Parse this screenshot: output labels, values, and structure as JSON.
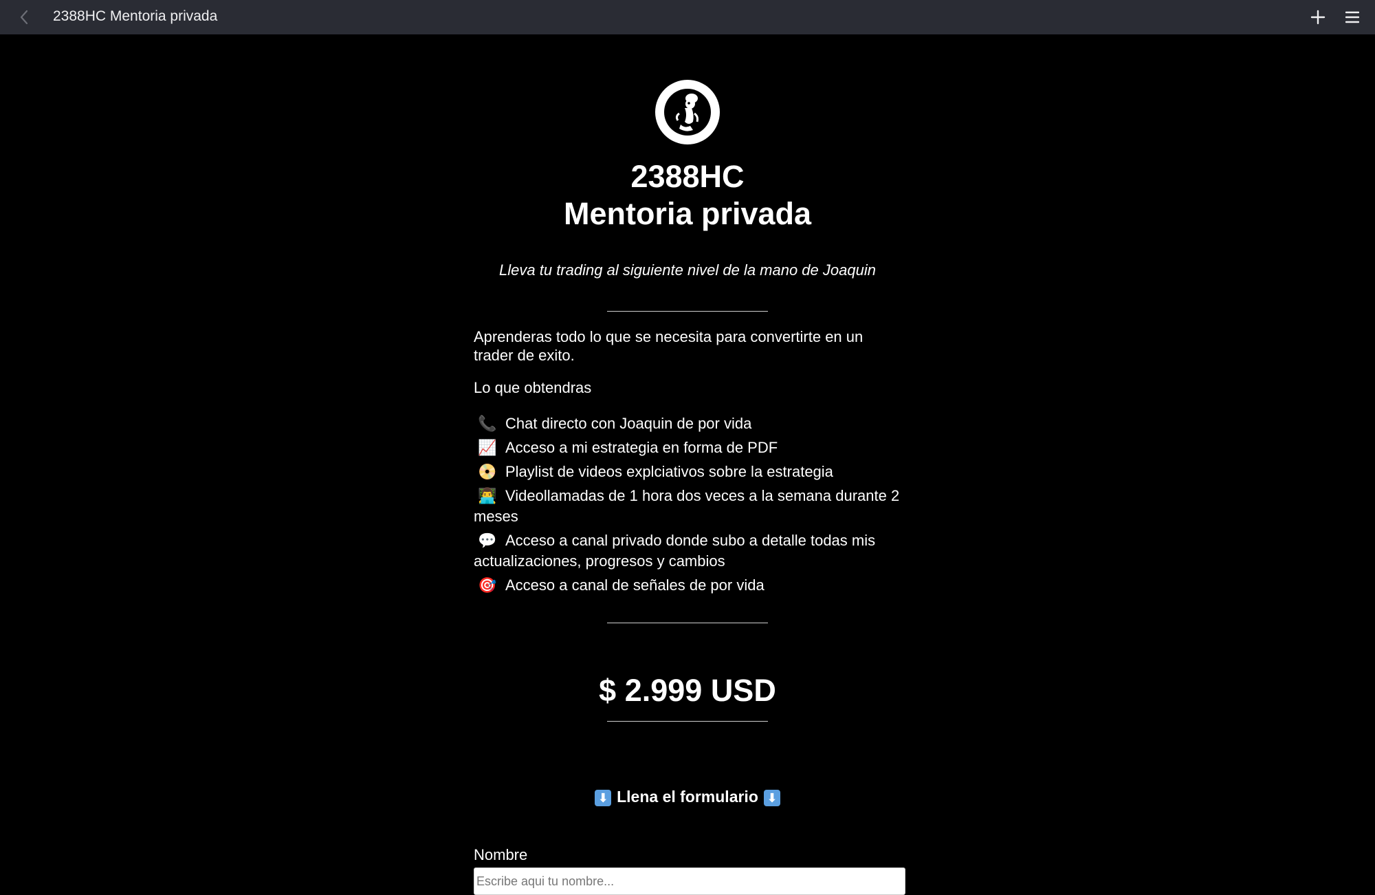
{
  "window": {
    "title": "2388HC Mentoria privada",
    "back_icon": "chevron-left-icon",
    "plus_icon": "plus-icon",
    "menu_icon": "hamburger-menu-icon"
  },
  "page": {
    "avatar_icon": "cartoon-character-logo",
    "title_line1": "2388HC",
    "title_line2": "Mentoria privada",
    "subtitle": "Lleva tu trading al siguiente nivel de la mano de Joaquin",
    "intro": "Aprenderas todo lo que se necesita para convertirte en un trader de exito.",
    "lo_que_label": "Lo que obtendras",
    "features": [
      {
        "emoji": "📞",
        "text": "Chat directo con Joaquin de por vida"
      },
      {
        "emoji": "📈",
        "text": "Acceso a mi estrategia en forma de PDF"
      },
      {
        "emoji": "📀",
        "text": "Playlist de videos explciativos sobre la estrategia"
      },
      {
        "emoji": "👨‍💻",
        "text": "Videollamadas de 1 hora dos veces a la semana durante 2 meses"
      },
      {
        "emoji": "💬",
        "text": "Acceso a canal privado donde subo a detalle todas mis actualizaciones, progresos y cambios"
      },
      {
        "emoji": "🎯",
        "text": "Acceso a canal de señales de por vida"
      }
    ],
    "price": "$ 2.999 USD",
    "form_heading": "Llena el formulario",
    "form_heading_arrow": "⬇",
    "name_label": "Nombre",
    "name_placeholder": "Escribe aqui tu nombre...",
    "name_value": ""
  },
  "colors": {
    "topbar_bg": "#2a2c34",
    "page_bg": "#000000",
    "text": "#ffffff",
    "arrow_box": "#5b9fe0"
  }
}
